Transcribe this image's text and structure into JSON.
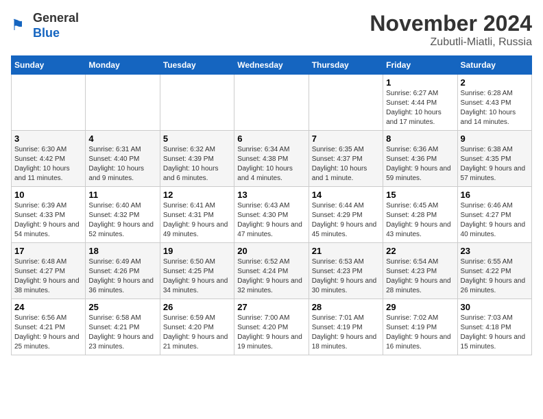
{
  "header": {
    "logo_general": "General",
    "logo_blue": "Blue",
    "main_title": "November 2024",
    "subtitle": "Zubutli-Miatli, Russia"
  },
  "days_of_week": [
    "Sunday",
    "Monday",
    "Tuesday",
    "Wednesday",
    "Thursday",
    "Friday",
    "Saturday"
  ],
  "weeks": [
    [
      {
        "day": "",
        "info": ""
      },
      {
        "day": "",
        "info": ""
      },
      {
        "day": "",
        "info": ""
      },
      {
        "day": "",
        "info": ""
      },
      {
        "day": "",
        "info": ""
      },
      {
        "day": "1",
        "info": "Sunrise: 6:27 AM\nSunset: 4:44 PM\nDaylight: 10 hours and 17 minutes."
      },
      {
        "day": "2",
        "info": "Sunrise: 6:28 AM\nSunset: 4:43 PM\nDaylight: 10 hours and 14 minutes."
      }
    ],
    [
      {
        "day": "3",
        "info": "Sunrise: 6:30 AM\nSunset: 4:42 PM\nDaylight: 10 hours and 11 minutes."
      },
      {
        "day": "4",
        "info": "Sunrise: 6:31 AM\nSunset: 4:40 PM\nDaylight: 10 hours and 9 minutes."
      },
      {
        "day": "5",
        "info": "Sunrise: 6:32 AM\nSunset: 4:39 PM\nDaylight: 10 hours and 6 minutes."
      },
      {
        "day": "6",
        "info": "Sunrise: 6:34 AM\nSunset: 4:38 PM\nDaylight: 10 hours and 4 minutes."
      },
      {
        "day": "7",
        "info": "Sunrise: 6:35 AM\nSunset: 4:37 PM\nDaylight: 10 hours and 1 minute."
      },
      {
        "day": "8",
        "info": "Sunrise: 6:36 AM\nSunset: 4:36 PM\nDaylight: 9 hours and 59 minutes."
      },
      {
        "day": "9",
        "info": "Sunrise: 6:38 AM\nSunset: 4:35 PM\nDaylight: 9 hours and 57 minutes."
      }
    ],
    [
      {
        "day": "10",
        "info": "Sunrise: 6:39 AM\nSunset: 4:33 PM\nDaylight: 9 hours and 54 minutes."
      },
      {
        "day": "11",
        "info": "Sunrise: 6:40 AM\nSunset: 4:32 PM\nDaylight: 9 hours and 52 minutes."
      },
      {
        "day": "12",
        "info": "Sunrise: 6:41 AM\nSunset: 4:31 PM\nDaylight: 9 hours and 49 minutes."
      },
      {
        "day": "13",
        "info": "Sunrise: 6:43 AM\nSunset: 4:30 PM\nDaylight: 9 hours and 47 minutes."
      },
      {
        "day": "14",
        "info": "Sunrise: 6:44 AM\nSunset: 4:29 PM\nDaylight: 9 hours and 45 minutes."
      },
      {
        "day": "15",
        "info": "Sunrise: 6:45 AM\nSunset: 4:28 PM\nDaylight: 9 hours and 43 minutes."
      },
      {
        "day": "16",
        "info": "Sunrise: 6:46 AM\nSunset: 4:27 PM\nDaylight: 9 hours and 40 minutes."
      }
    ],
    [
      {
        "day": "17",
        "info": "Sunrise: 6:48 AM\nSunset: 4:27 PM\nDaylight: 9 hours and 38 minutes."
      },
      {
        "day": "18",
        "info": "Sunrise: 6:49 AM\nSunset: 4:26 PM\nDaylight: 9 hours and 36 minutes."
      },
      {
        "day": "19",
        "info": "Sunrise: 6:50 AM\nSunset: 4:25 PM\nDaylight: 9 hours and 34 minutes."
      },
      {
        "day": "20",
        "info": "Sunrise: 6:52 AM\nSunset: 4:24 PM\nDaylight: 9 hours and 32 minutes."
      },
      {
        "day": "21",
        "info": "Sunrise: 6:53 AM\nSunset: 4:23 PM\nDaylight: 9 hours and 30 minutes."
      },
      {
        "day": "22",
        "info": "Sunrise: 6:54 AM\nSunset: 4:23 PM\nDaylight: 9 hours and 28 minutes."
      },
      {
        "day": "23",
        "info": "Sunrise: 6:55 AM\nSunset: 4:22 PM\nDaylight: 9 hours and 26 minutes."
      }
    ],
    [
      {
        "day": "24",
        "info": "Sunrise: 6:56 AM\nSunset: 4:21 PM\nDaylight: 9 hours and 25 minutes."
      },
      {
        "day": "25",
        "info": "Sunrise: 6:58 AM\nSunset: 4:21 PM\nDaylight: 9 hours and 23 minutes."
      },
      {
        "day": "26",
        "info": "Sunrise: 6:59 AM\nSunset: 4:20 PM\nDaylight: 9 hours and 21 minutes."
      },
      {
        "day": "27",
        "info": "Sunrise: 7:00 AM\nSunset: 4:20 PM\nDaylight: 9 hours and 19 minutes."
      },
      {
        "day": "28",
        "info": "Sunrise: 7:01 AM\nSunset: 4:19 PM\nDaylight: 9 hours and 18 minutes."
      },
      {
        "day": "29",
        "info": "Sunrise: 7:02 AM\nSunset: 4:19 PM\nDaylight: 9 hours and 16 minutes."
      },
      {
        "day": "30",
        "info": "Sunrise: 7:03 AM\nSunset: 4:18 PM\nDaylight: 9 hours and 15 minutes."
      }
    ]
  ]
}
